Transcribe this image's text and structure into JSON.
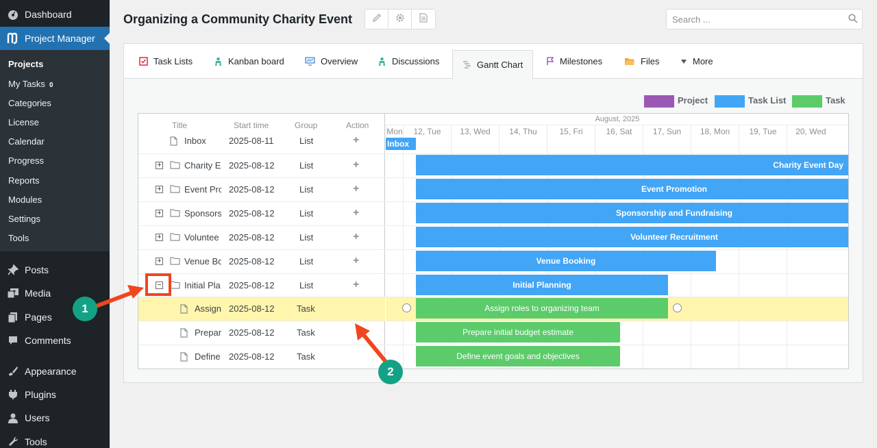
{
  "wp_menu": {
    "dashboard": "Dashboard",
    "project_manager": "Project Manager",
    "submenu": [
      {
        "label": "Projects",
        "current": true
      },
      {
        "label": "My Tasks",
        "badge": "0"
      },
      {
        "label": "Categories"
      },
      {
        "label": "License"
      },
      {
        "label": "Calendar"
      },
      {
        "label": "Progress"
      },
      {
        "label": "Reports"
      },
      {
        "label": "Modules"
      },
      {
        "label": "Settings"
      },
      {
        "label": "Tools"
      }
    ],
    "posts": "Posts",
    "media": "Media",
    "pages": "Pages",
    "comments": "Comments",
    "appearance": "Appearance",
    "plugins": "Plugins",
    "users": "Users",
    "tools": "Tools"
  },
  "header": {
    "title": "Organizing a Community Charity Event",
    "search_placeholder": "Search ..."
  },
  "tabs": [
    {
      "label": "Task Lists",
      "icon": "task-lists-icon"
    },
    {
      "label": "Kanban board",
      "icon": "kanban-icon"
    },
    {
      "label": "Overview",
      "icon": "overview-icon"
    },
    {
      "label": "Discussions",
      "icon": "discussions-icon"
    },
    {
      "label": "Gantt Chart",
      "icon": "gantt-icon",
      "active": true
    },
    {
      "label": "Milestones",
      "icon": "milestones-icon"
    },
    {
      "label": "Files",
      "icon": "files-icon"
    },
    {
      "label": "More",
      "icon": "caret-down-icon"
    }
  ],
  "legend": {
    "project": "Project",
    "task_list": "Task List",
    "task": "Task",
    "colors": {
      "project": "#9b59b6",
      "task_list": "#42a5f5",
      "task": "#5ccb6a"
    }
  },
  "gantt": {
    "columns": {
      "title": "Title",
      "start": "Start time",
      "group": "Group",
      "action": "Action"
    },
    "month": "August, 2025",
    "days": [
      "Mon",
      "12, Tue",
      "13, Wed",
      "14, Thu",
      "15, Fri",
      "16, Sat",
      "17, Sun",
      "18, Mon",
      "19, Tue",
      "20, Wed"
    ],
    "rows": [
      {
        "title": "Inbox",
        "start": "2025-08-11",
        "group": "List",
        "bar": "Inbox"
      },
      {
        "title": "Charity E",
        "start": "2025-08-12",
        "group": "List",
        "bar": "Charity Event Day"
      },
      {
        "title": "Event Pro",
        "start": "2025-08-12",
        "group": "List",
        "bar": "Event Promotion"
      },
      {
        "title": "Sponsors",
        "start": "2025-08-12",
        "group": "List",
        "bar": "Sponsorship and Fundraising"
      },
      {
        "title": "Voluntee",
        "start": "2025-08-12",
        "group": "List",
        "bar": "Volunteer Recruitment"
      },
      {
        "title": "Venue Bo",
        "start": "2025-08-12",
        "group": "List",
        "bar": "Venue Booking"
      },
      {
        "title": "Initial Pla",
        "start": "2025-08-12",
        "group": "List",
        "bar": "Initial Planning"
      },
      {
        "title": "Assign",
        "start": "2025-08-12",
        "group": "Task",
        "bar": "Assign roles to organizing team"
      },
      {
        "title": "Prepar",
        "start": "2025-08-12",
        "group": "Task",
        "bar": "Prepare initial budget estimate"
      },
      {
        "title": "Define",
        "start": "2025-08-12",
        "group": "Task",
        "bar": "Define event goals and objectives"
      }
    ]
  },
  "annotations": {
    "badge1": "1",
    "badge2": "2"
  }
}
